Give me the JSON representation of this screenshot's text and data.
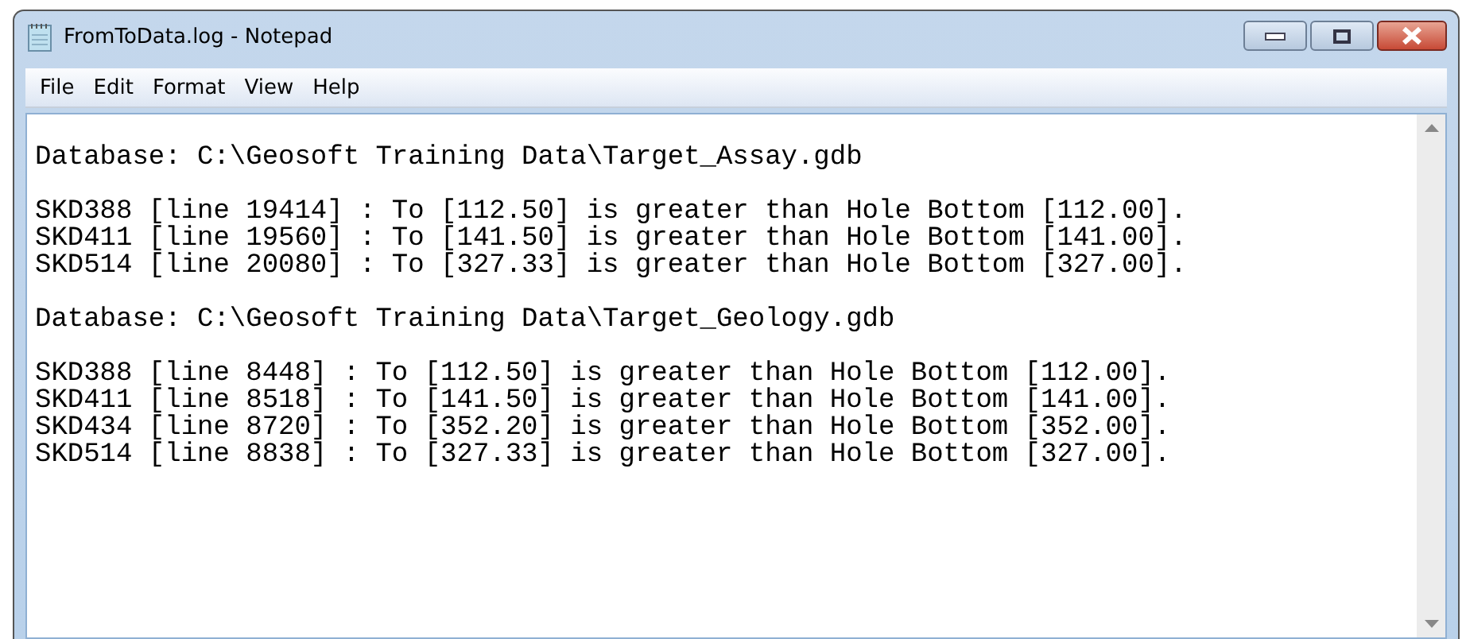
{
  "window": {
    "title": "FromToData.log - Notepad"
  },
  "menu": [
    {
      "label": "File"
    },
    {
      "label": "Edit"
    },
    {
      "label": "Format"
    },
    {
      "label": "View"
    },
    {
      "label": "Help"
    }
  ],
  "document": {
    "paragraphs": [
      [
        "Database: C:\\Geosoft Training Data\\Target_Assay.gdb"
      ],
      [
        "SKD388 [line 19414] : To [112.50] is greater than Hole Bottom [112.00].",
        "SKD411 [line 19560] : To [141.50] is greater than Hole Bottom [141.00].",
        "SKD514 [line 20080] : To [327.33] is greater than Hole Bottom [327.00]."
      ],
      [
        "Database: C:\\Geosoft Training Data\\Target_Geology.gdb"
      ],
      [
        "SKD388 [line 8448] : To [112.50] is greater than Hole Bottom [112.00].",
        "SKD411 [line 8518] : To [141.50] is greater than Hole Bottom [141.00].",
        "SKD434 [line 8720] : To [352.20] is greater than Hole Bottom [352.00].",
        "SKD514 [line 8838] : To [327.33] is greater than Hole Bottom [327.00]."
      ]
    ]
  }
}
